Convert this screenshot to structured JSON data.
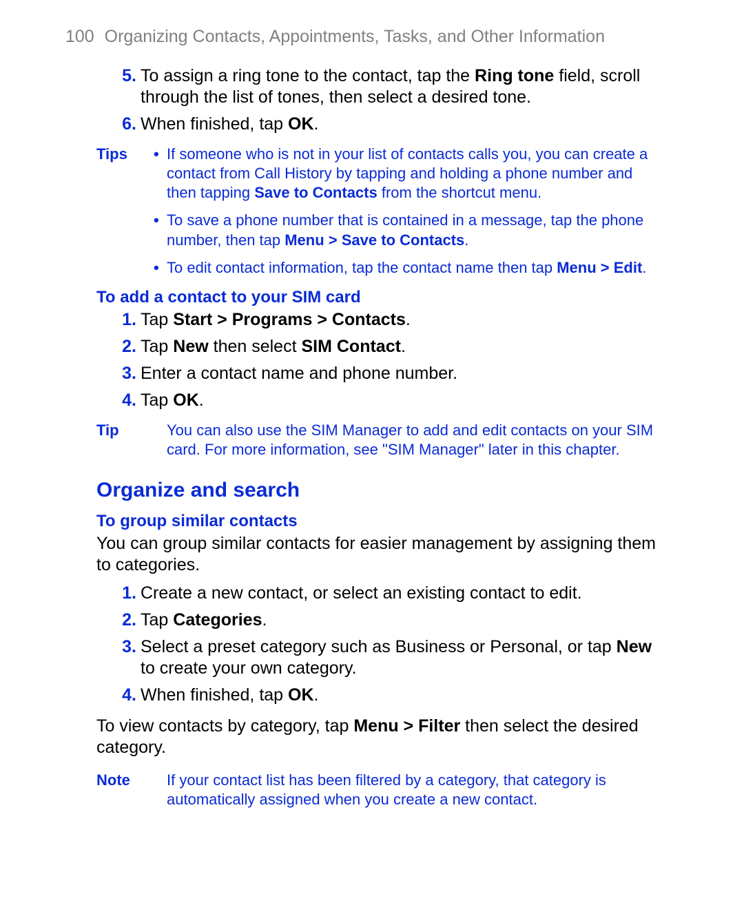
{
  "header": {
    "page_number": "100",
    "title": "Organizing Contacts, Appointments, Tasks, and Other Information"
  },
  "topSteps": {
    "5": {
      "num": "5.",
      "pre": "To assign a ring tone to the contact, tap the ",
      "bold": "Ring tone",
      "post": " field, scroll through the list of tones, then select a desired tone."
    },
    "6": {
      "num": "6.",
      "pre": "When finished, tap ",
      "bold": "OK",
      "post": "."
    }
  },
  "tips1": {
    "label": "Tips",
    "items": {
      "0": {
        "pre": "If someone who is not in your list of contacts calls you, you can create a contact from Call History by tapping and holding a phone number and then tapping ",
        "bold": "Save to Contacts",
        "post": " from the shortcut menu."
      },
      "1": {
        "pre": "To save a phone number that is contained in a message, tap the phone number, then tap ",
        "bold": "Menu > Save to Contacts",
        "post": "."
      },
      "2": {
        "pre": "To edit contact information, tap the contact name then tap ",
        "bold": "Menu > Edit",
        "post": "."
      }
    }
  },
  "simHeading": "To add a contact to your SIM card",
  "simSteps": {
    "1": {
      "num": "1.",
      "pre": "Tap ",
      "bold": "Start > Programs > Contacts",
      "post": "."
    },
    "2": {
      "num": "2.",
      "pre": "Tap ",
      "bold": "New",
      "mid": " then select ",
      "bold2": "SIM Contact",
      "post": "."
    },
    "3": {
      "num": "3.",
      "text": "Enter a contact name and phone number."
    },
    "4": {
      "num": "4.",
      "pre": "Tap ",
      "bold": "OK",
      "post": "."
    }
  },
  "tip2": {
    "label": "Tip",
    "text": "You can also use the SIM Manager to add and edit contacts on your SIM card. For more information, see \"SIM Manager\" later in this chapter."
  },
  "section": "Organize and search",
  "groupHeading": "To group similar contacts",
  "groupIntro": "You can group similar contacts for easier management by assigning them to categories.",
  "groupSteps": {
    "1": {
      "num": "1.",
      "text": "Create a new contact, or select an existing contact to edit."
    },
    "2": {
      "num": "2.",
      "pre": "Tap ",
      "bold": "Categories",
      "post": "."
    },
    "3": {
      "num": "3.",
      "pre": "Select a preset category such as Business or Personal, or tap ",
      "bold": "New",
      "post": " to create your own category."
    },
    "4": {
      "num": "4.",
      "pre": "When finished, tap ",
      "bold": "OK",
      "post": "."
    }
  },
  "filterPara": {
    "pre": "To view contacts by category, tap ",
    "bold": "Menu > Filter",
    "post": " then select the desired category."
  },
  "note": {
    "label": "Note",
    "text": "If your contact list has been filtered by a category, that category is automatically assigned when you create a new contact."
  }
}
